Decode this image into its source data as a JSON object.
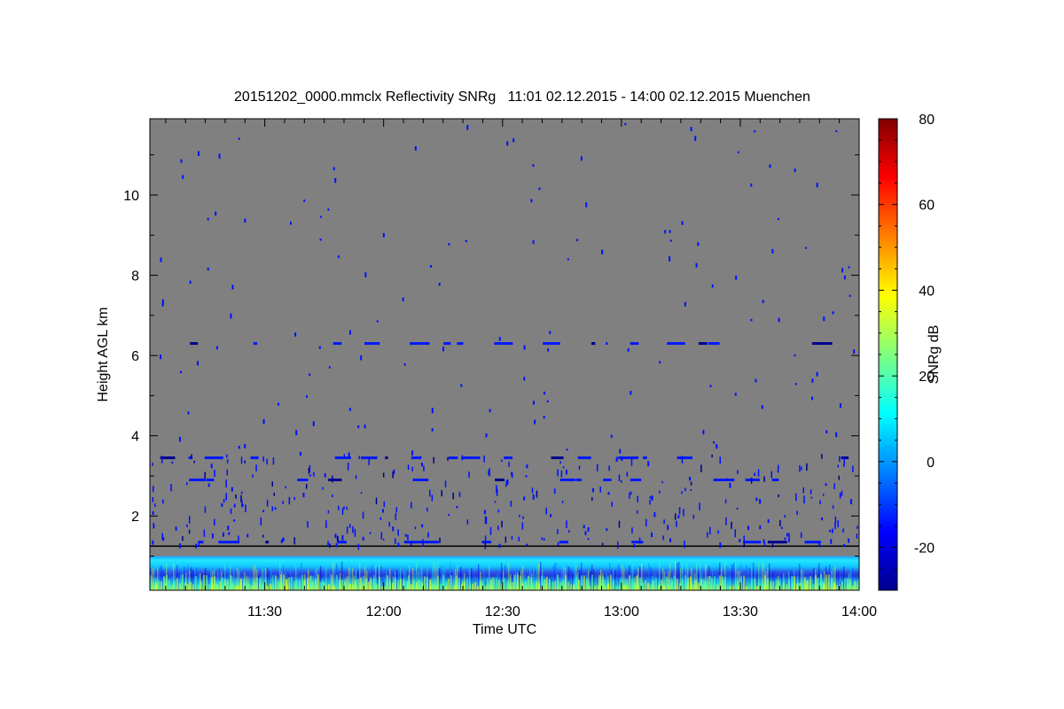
{
  "chart_data": {
    "type": "heatmap",
    "title": "20151202_0000.mmclx Reflectivity SNRg   11:01 02.12.2015 - 14:00 02.12.2015 Muenchen",
    "xlabel": "Time UTC",
    "ylabel": "Height AGL km",
    "colorbar_label": "SNRg dB",
    "x_range": [
      "11:01",
      "14:00"
    ],
    "xticks": [
      "11:30",
      "12:00",
      "12:30",
      "13:00",
      "13:30",
      "14:00"
    ],
    "ylim": [
      0.15,
      11.9
    ],
    "yticks": [
      2,
      4,
      6,
      8,
      10
    ],
    "colorbar_range": [
      -30,
      80
    ],
    "colorbar_ticks": [
      -20,
      0,
      20,
      40,
      60,
      80
    ],
    "colormap": "jet",
    "background_color": "#808080",
    "features": [
      {
        "name": "surface echo layer",
        "height_km": [
          0.15,
          1.0
        ],
        "snr_db": [
          -25,
          40
        ]
      },
      {
        "name": "separator line",
        "height_km": 1.25
      },
      {
        "name": "speckle band",
        "height_km": 1.35
      },
      {
        "name": "speckle band",
        "height_km": 2.9
      },
      {
        "name": "speckle band",
        "height_km": 3.45
      },
      {
        "name": "speckle band",
        "height_km": 6.3
      }
    ]
  }
}
